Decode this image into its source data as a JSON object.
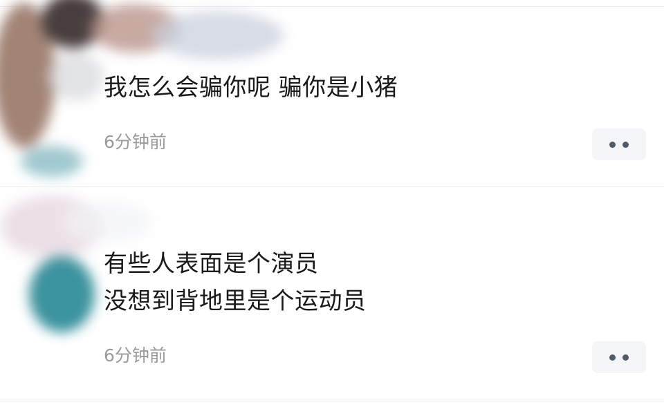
{
  "comments": [
    {
      "lines": [
        "我怎么会骗你呢 骗你是小猪"
      ],
      "time": "6分钟前",
      "more_icon": "more-dots-icon"
    },
    {
      "lines": [
        "有些人表面是个演员",
        "没想到背地里是个运动员"
      ],
      "time": "6分钟前",
      "more_icon": "more-dots-icon"
    }
  ]
}
